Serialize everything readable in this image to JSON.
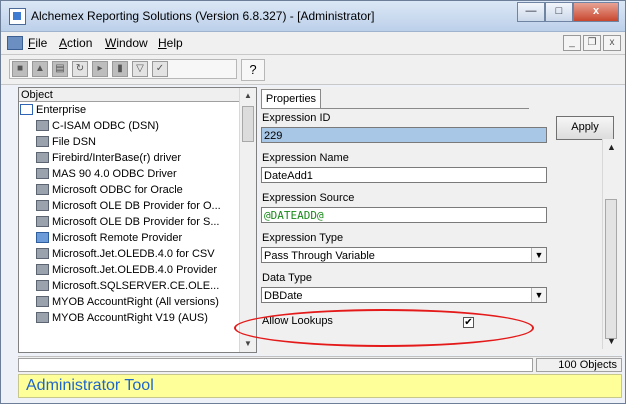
{
  "window": {
    "title": "Alchemex Reporting Solutions (Version 6.8.327) - [Administrator]",
    "minimize_icon": "minimize-icon",
    "maximize_icon": "maximize-icon",
    "close_label": "x"
  },
  "menu": {
    "items": [
      {
        "label": "File",
        "underline": "F"
      },
      {
        "label": "Action",
        "underline": "A"
      },
      {
        "label": "Window",
        "underline": "W"
      },
      {
        "label": "Help",
        "underline": "H"
      }
    ],
    "mdi_buttons": [
      "_",
      "❐",
      "x"
    ]
  },
  "toolbar": {
    "help_icon": "?"
  },
  "tree": {
    "header": "Object",
    "root": "Enterprise",
    "items": [
      "C-ISAM ODBC (DSN)",
      "File DSN",
      "Firebird/InterBase(r) driver",
      "MAS 90 4.0 ODBC Driver",
      "Microsoft ODBC for Oracle",
      "Microsoft OLE DB Provider for O...",
      "Microsoft OLE DB Provider for S...",
      "Microsoft Remote Provider",
      "Microsoft.Jet.OLEDB.4.0 for CSV",
      "Microsoft.Jet.OLEDB.4.0 Provider",
      "Microsoft.SQLSERVER.CE.OLE...",
      "MYOB AccountRight (All versions)",
      "MYOB AccountRight V19 (AUS)"
    ]
  },
  "properties": {
    "tab_label": "Properties",
    "apply_label": "Apply",
    "expression_id_label": "Expression ID",
    "expression_id_value": "229",
    "expression_name_label": "Expression Name",
    "expression_name_value": "DateAdd1",
    "expression_source_label": "Expression Source",
    "expression_source_value": "@DATEADD@",
    "expression_type_label": "Expression Type",
    "expression_type_value": "Pass Through Variable",
    "data_type_label": "Data Type",
    "data_type_value": "DBDate",
    "allow_lookups_label": "Allow Lookups",
    "allow_lookups_checked": "✔"
  },
  "status": {
    "count": "100 Objects"
  },
  "admin_bar": {
    "label": "Administrator Tool"
  },
  "colors": {
    "highlight_oval": "#e41a1a",
    "admin_bar_bg": "#ffff99",
    "admin_bar_text": "#1e66cc",
    "selected_field": "#a8c6e6",
    "source_text": "#1a8a1a"
  }
}
